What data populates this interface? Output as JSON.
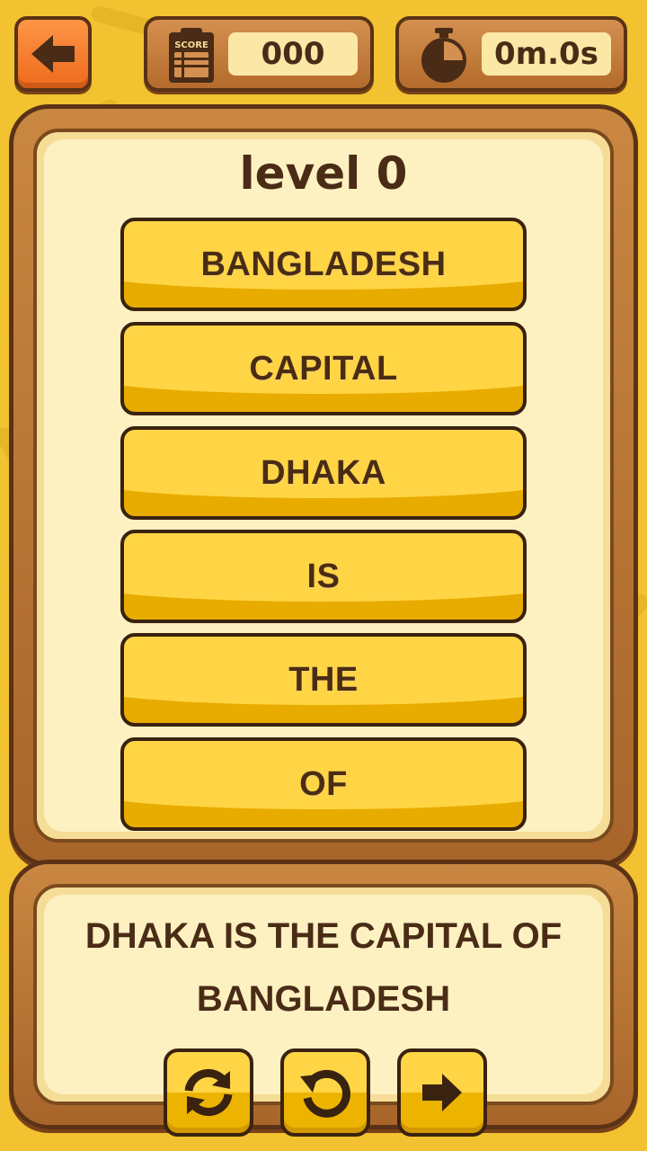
{
  "header": {
    "back_icon": "arrow-left-icon",
    "score_label": "SCORE",
    "score_value": "000",
    "timer_icon": "stopwatch-icon",
    "timer_value": "0m.0s"
  },
  "level": {
    "title": "level 0"
  },
  "words": [
    "BANGLADESH",
    "CAPITAL",
    "DHAKA",
    "IS",
    "THE",
    "OF"
  ],
  "answer": {
    "sentence": "DHAKA IS THE CAPITAL OF BANGLADESH"
  },
  "controls": {
    "shuffle_icon": "shuffle-icon",
    "reset_icon": "reset-icon",
    "next_icon": "arrow-right-icon"
  },
  "colors": {
    "background": "#f2c230",
    "frame": "#b46b2c",
    "panel": "#fdf1c2",
    "word_button": "#ffd545",
    "back_button": "#ee6a1c",
    "text": "#4a2c16"
  }
}
